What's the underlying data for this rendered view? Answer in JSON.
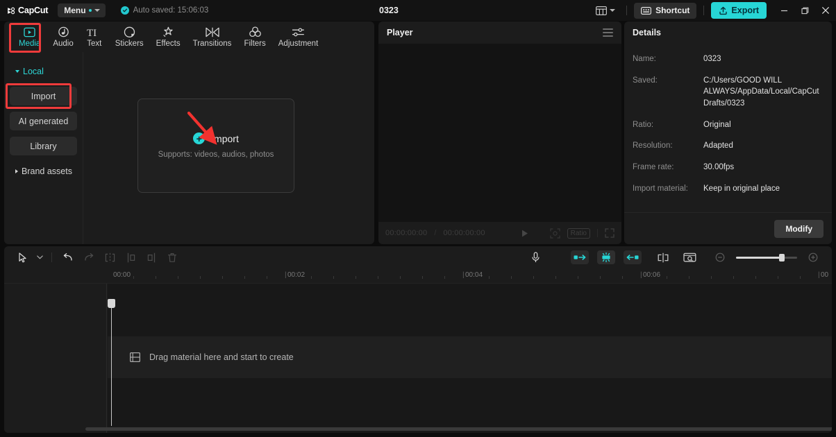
{
  "titlebar": {
    "brand": "CapCut",
    "brand_icon": "capcut-logo-icon",
    "menu_label": "Menu",
    "autosave_text": "Auto saved: 15:06:03",
    "autosave_icon": "check-circle-icon",
    "project_title": "0323",
    "layout_icon": "layout-icon",
    "shortcut_label": "Shortcut",
    "shortcut_icon": "keyboard-icon",
    "export_label": "Export",
    "export_icon": "upload-icon",
    "minimize_icon": "minimize-icon",
    "maximize_icon": "restore-icon",
    "close_icon": "close-icon",
    "accent_color": "#27d6d6",
    "highlight_color": "#f03b3b"
  },
  "tabs": [
    {
      "label": "Media",
      "icon": "media-play-icon",
      "active": true
    },
    {
      "label": "Audio",
      "icon": "audio-note-icon",
      "active": false
    },
    {
      "label": "Text",
      "icon": "text-ti-icon",
      "active": false
    },
    {
      "label": "Stickers",
      "icon": "sticker-icon",
      "active": false
    },
    {
      "label": "Effects",
      "icon": "effects-star-icon",
      "active": false
    },
    {
      "label": "Transitions",
      "icon": "transitions-icon",
      "active": false
    },
    {
      "label": "Filters",
      "icon": "filters-icon",
      "active": false
    },
    {
      "label": "Adjustment",
      "icon": "adjustment-icon",
      "active": false
    }
  ],
  "sidebar": {
    "items": [
      {
        "label": "Local",
        "type": "group",
        "expanded": true
      },
      {
        "label": "Import",
        "type": "sub",
        "highlighted": true
      },
      {
        "label": "AI generated",
        "type": "sub"
      },
      {
        "label": "Library",
        "type": "sub"
      },
      {
        "label": "Brand assets",
        "type": "group",
        "expanded": false
      }
    ]
  },
  "dropzone": {
    "label": "Import",
    "plus_icon": "plus-circle-icon",
    "supports": "Supports: videos, audios, photos"
  },
  "player": {
    "title": "Player",
    "menu_icon": "hamburger-icon",
    "current_time": "00:00:00:00",
    "separator": "/",
    "total_time": "00:00:00:00",
    "play_icon": "play-icon",
    "crop_icon": "crop-icon",
    "ratio_label": "Ratio",
    "fullscreen_icon": "fullscreen-icon"
  },
  "details": {
    "title": "Details",
    "rows": [
      {
        "key": "Name:",
        "value": "0323"
      },
      {
        "key": "Saved:",
        "value": "C:/Users/GOOD WILL ALWAYS/AppData/Local/CapCut Drafts/0323"
      },
      {
        "key": "Ratio:",
        "value": "Original"
      },
      {
        "key": "Resolution:",
        "value": "Adapted"
      },
      {
        "key": "Frame rate:",
        "value": "30.00fps"
      },
      {
        "key": "Import material:",
        "value": "Keep in original place"
      }
    ],
    "modify_label": "Modify"
  },
  "timeline": {
    "tools_left": [
      {
        "icon": "select-cursor-icon",
        "enabled": true
      },
      {
        "icon": "chevron-down-icon",
        "enabled": true
      },
      {
        "icon": "undo-icon",
        "enabled": true
      },
      {
        "icon": "redo-icon",
        "enabled": false
      },
      {
        "icon": "split-icon",
        "enabled": false
      },
      {
        "icon": "trim-left-icon",
        "enabled": false
      },
      {
        "icon": "trim-right-icon",
        "enabled": false
      },
      {
        "icon": "delete-icon",
        "enabled": false
      }
    ],
    "tools_right": [
      {
        "icon": "microphone-icon",
        "enabled": true
      },
      {
        "icon": "auto-cut-start-icon",
        "enabled": true
      },
      {
        "icon": "auto-cut-mid-icon",
        "enabled": true
      },
      {
        "icon": "auto-cut-end-icon",
        "enabled": true
      },
      {
        "icon": "mirror-icon",
        "enabled": true
      },
      {
        "icon": "freeze-frame-icon",
        "enabled": true
      },
      {
        "icon": "zoom-out-icon",
        "enabled": true
      },
      {
        "icon": "zoom-in-icon",
        "enabled": true
      }
    ],
    "ruler_labels": [
      "00:00",
      "00:02",
      "00:04",
      "00:06",
      "00"
    ],
    "drop_hint": "Drag material here and start to create",
    "drop_hint_icon": "film-strip-icon"
  }
}
